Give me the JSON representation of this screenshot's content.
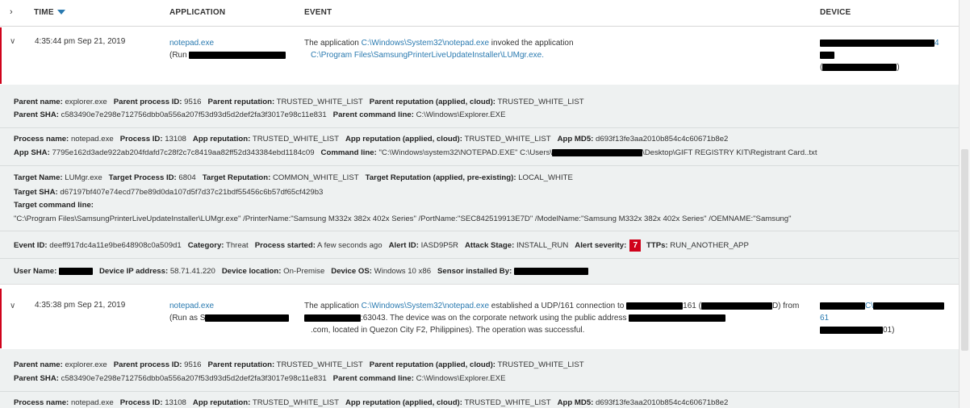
{
  "header": {
    "expand": "›",
    "time": "TIME",
    "application": "APPLICATION",
    "event": "EVENT",
    "device": "DEVICE"
  },
  "events": [
    {
      "time": "4:35:44 pm Sep 21, 2019",
      "app": "notepad.exe",
      "run_prefix": "(Run ",
      "event_prefix": "The application ",
      "event_link1": "C:\\Windows\\System32\\notepad.exe",
      "event_mid": " invoked the application",
      "event_link2": "C:\\Program Files\\SamsungPrinterLiveUpdateInstaller\\LUMgr.exe.",
      "device_tail": "4",
      "device_paren_open": "(",
      "device_paren_close": ")"
    },
    {
      "time": "4:35:38 pm Sep 21, 2019",
      "app": "notepad.exe",
      "run_prefix": "(Run as S",
      "event_prefix": "The application ",
      "event_link1": "C:\\Windows\\System32\\notepad.exe",
      "event_mid": " established a UDP/161 connection to ",
      "event_mid2": "161 (",
      "event_mid3": "D) from",
      "event_line2": ":63043. The device was on the corporate network using the public address ",
      "event_line3": ".com, located in Quezon City F2, Philippines). The operation was successful.",
      "device_mid": "C\\",
      "device_line2": "61",
      "device_line3": "01)"
    }
  ],
  "details1": {
    "parent_name_label": "Parent name:",
    "parent_name": "explorer.exe",
    "parent_pid_label": "Parent process ID:",
    "parent_pid": "9516",
    "parent_rep_label": "Parent reputation:",
    "parent_rep": "TRUSTED_WHITE_LIST",
    "parent_rep_applied_label": "Parent reputation (applied, cloud):",
    "parent_rep_applied": "TRUSTED_WHITE_LIST",
    "parent_sha_label": "Parent SHA:",
    "parent_sha": "c583490e7e298e712756dbb0a556a207f53d93d5d2def2fa3f3017e98c11e831",
    "parent_cmd_label": "Parent command line:",
    "parent_cmd": "C:\\Windows\\Explorer.EXE",
    "process_name_label": "Process name:",
    "process_name": "notepad.exe",
    "pid_label": "Process ID:",
    "pid": "13108",
    "app_rep_label": "App reputation:",
    "app_rep": "TRUSTED_WHITE_LIST",
    "app_rep_applied_label": "App reputation (applied, cloud):",
    "app_rep_applied": "TRUSTED_WHITE_LIST",
    "app_md5_label": "App MD5:",
    "app_md5": "d693f13fe3aa2010b854c4c60671b8e2",
    "app_sha_label": "App SHA:",
    "app_sha": "7795e162d3ade922ab204fdafd7c28f2c7c8419aa82ff52d343384ebd1184c09",
    "cmd_label": "Command line:",
    "cmd_prefix": "\"C:\\Windows\\system32\\NOTEPAD.EXE\" C:\\Users\\",
    "cmd_suffix": "\\Desktop\\GIFT REGISTRY KIT\\Registrant Card..txt",
    "target_name_label": "Target Name:",
    "target_name": "LUMgr.exe",
    "target_pid_label": "Target Process ID:",
    "target_pid": "6804",
    "target_rep_label": "Target Reputation:",
    "target_rep": "COMMON_WHITE_LIST",
    "target_rep_applied_label": "Target Reputation (applied, pre-existing):",
    "target_rep_applied": "LOCAL_WHITE",
    "target_sha_label": "Target SHA:",
    "target_sha": "d67197bf407e74ecd77be89d0da107d5f7d37c21bdf55456c6b57df65cf429b3",
    "target_cmd_label": "Target command line:",
    "target_cmd": "\"C:\\Program Files\\SamsungPrinterLiveUpdateInstaller\\LUMgr.exe\" /PrinterName:\"Samsung M332x 382x 402x Series\" /PortName:\"SEC842519913E7D\" /ModelName:\"Samsung M332x 382x 402x Series\" /OEMNAME:\"Samsung\"",
    "event_id_label": "Event ID:",
    "event_id": "deeff917dc4a11e9be648908c0a509d1",
    "category_label": "Category:",
    "category": "Threat",
    "started_label": "Process started:",
    "started": "A few seconds ago",
    "alert_id_label": "Alert ID:",
    "alert_id": "IASD9P5R",
    "stage_label": "Attack Stage:",
    "stage": "INSTALL_RUN",
    "severity_label": "Alert severity:",
    "severity": "7",
    "ttps_label": "TTPs:",
    "ttps": "RUN_ANOTHER_APP",
    "user_label": "User Name:",
    "ip_label": "Device IP address:",
    "ip": "58.71.41.220",
    "location_label": "Device location:",
    "location": "On-Premise",
    "os_label": "Device OS:",
    "os": "Windows 10 x86",
    "sensor_label": "Sensor installed By:"
  },
  "details2": {
    "parent_name_label": "Parent name:",
    "parent_name": "explorer.exe",
    "parent_pid_label": "Parent process ID:",
    "parent_pid": "9516",
    "parent_rep_label": "Parent reputation:",
    "parent_rep": "TRUSTED_WHITE_LIST",
    "parent_rep_applied_label": "Parent reputation (applied, cloud):",
    "parent_rep_applied": "TRUSTED_WHITE_LIST",
    "parent_sha_label": "Parent SHA:",
    "parent_sha": "c583490e7e298e712756dbb0a556a207f53d93d5d2def2fa3f3017e98c11e831",
    "parent_cmd_label": "Parent command line:",
    "parent_cmd": "C:\\Windows\\Explorer.EXE",
    "process_name_label": "Process name:",
    "process_name": "notepad.exe",
    "pid_label": "Process ID:",
    "pid": "13108",
    "app_rep_label": "App reputation:",
    "app_rep": "TRUSTED_WHITE_LIST",
    "app_rep_applied_label": "App reputation (applied, cloud):",
    "app_rep_applied": "TRUSTED_WHITE_LIST",
    "app_md5_label": "App MD5:",
    "app_md5": "d693f13fe3aa2010b854c4c60671b8e2"
  },
  "colors": {
    "accent_link": "#2a7ab0",
    "severity_red": "#d0021b",
    "details_bg": "#eef1f1"
  }
}
